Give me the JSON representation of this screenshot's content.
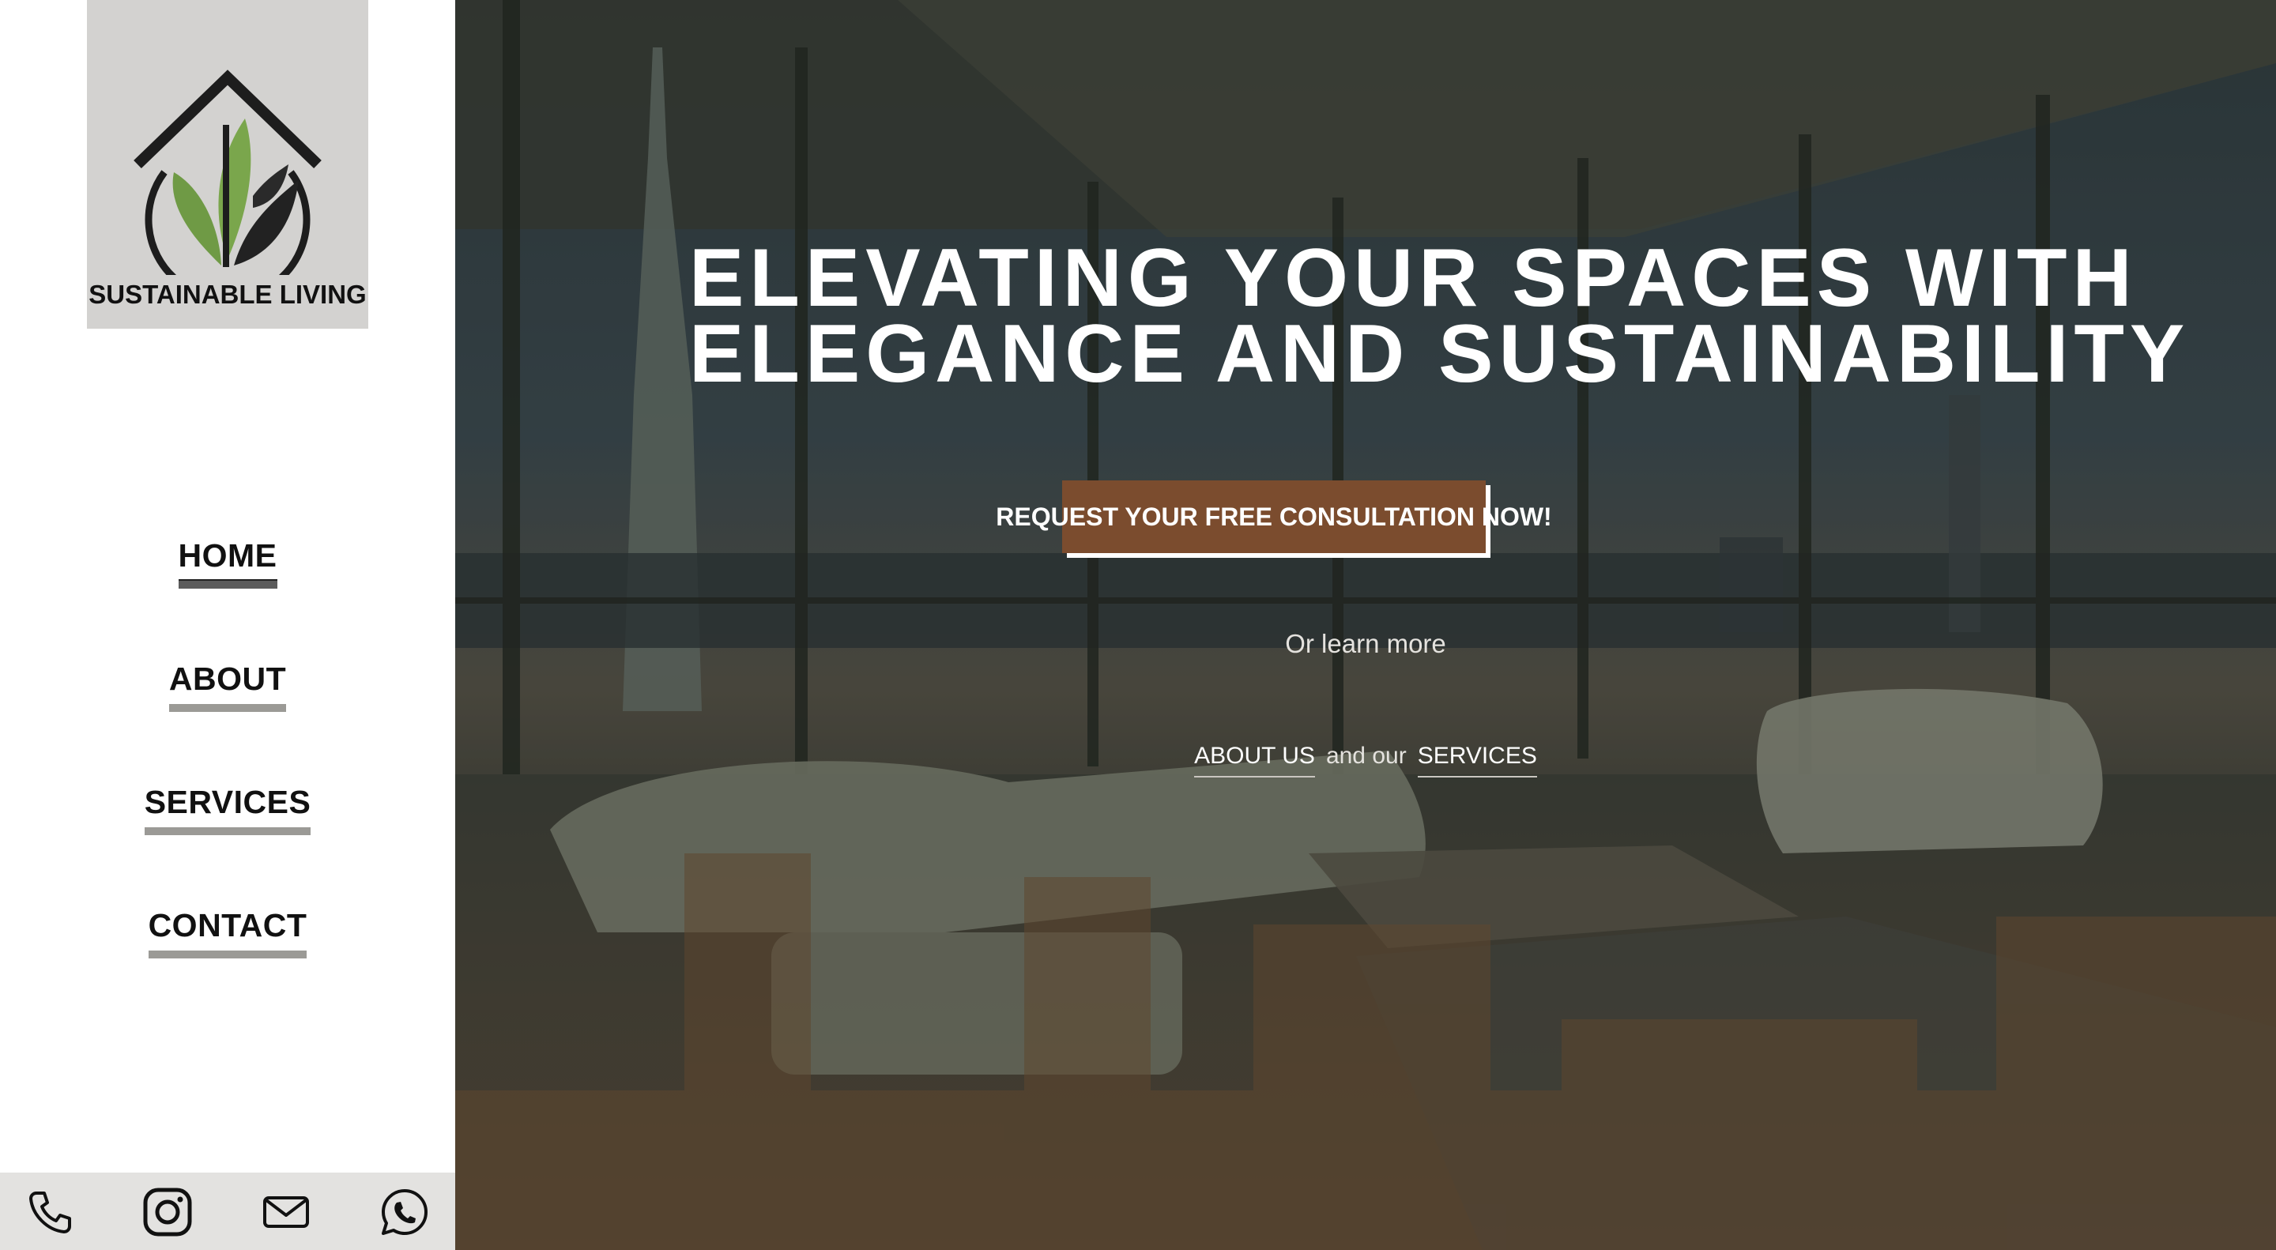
{
  "brand": {
    "logo_text": "SUSTAINABLE LIVING"
  },
  "nav": {
    "items": [
      {
        "label": "HOME",
        "active": true
      },
      {
        "label": "ABOUT",
        "active": false
      },
      {
        "label": "SERVICES",
        "active": false
      },
      {
        "label": "CONTACT",
        "active": false
      }
    ]
  },
  "social": {
    "icons": [
      "phone-icon",
      "instagram-icon",
      "mail-icon",
      "whatsapp-icon"
    ]
  },
  "hero": {
    "headline_line1": "ELEVATING YOUR SPACES WITH",
    "headline_line2": "ELEGANCE AND SUSTAINABILITY",
    "cta_label": "REQUEST YOUR FREE CONSULTATION NOW!",
    "learn_more": "Or learn more",
    "link_about": "ABOUT US",
    "link_connector": "and our",
    "link_services": "SERVICES"
  },
  "colors": {
    "accent_brown": "#7b4c2e",
    "logo_bg": "#d3d2d0",
    "leaf_green": "#6f9a45",
    "nav_underline": "#9b9a96",
    "social_bar": "#e3e2e0"
  }
}
